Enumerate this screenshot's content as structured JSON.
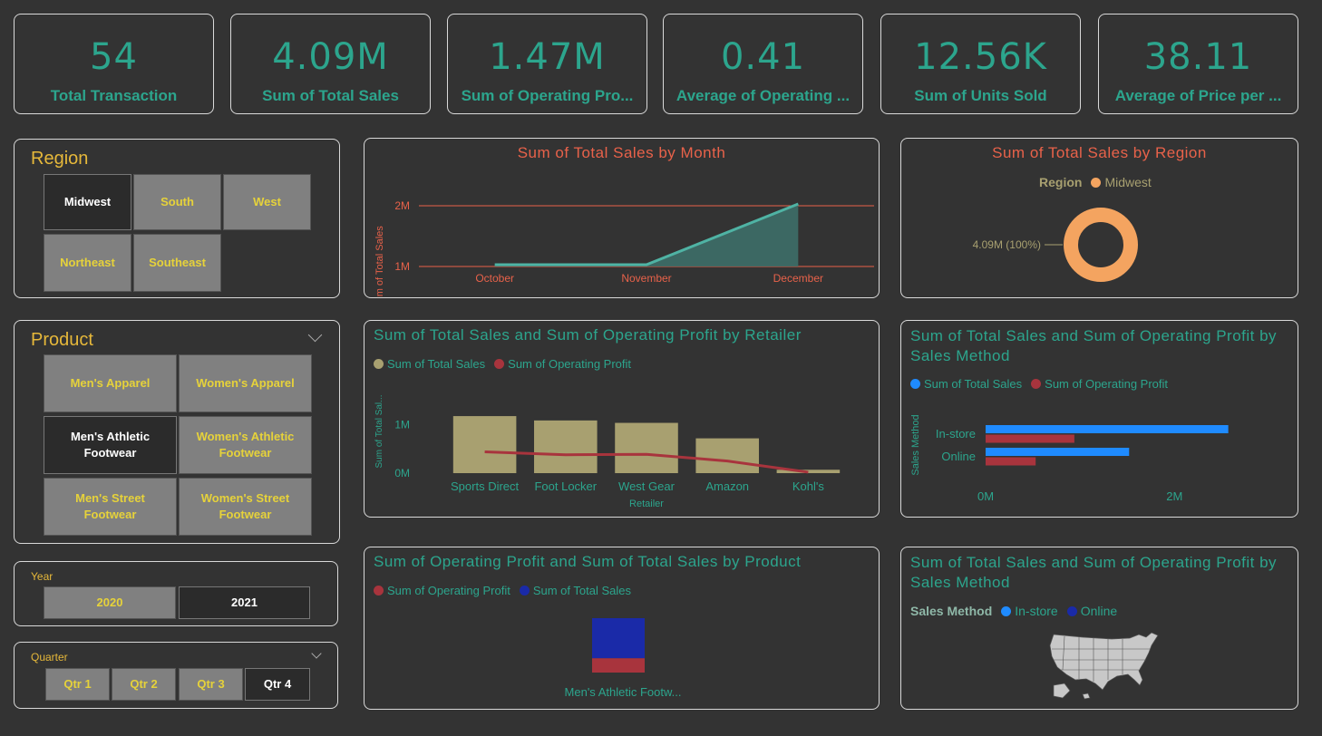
{
  "kpis": [
    {
      "value": "54",
      "label": "Total Transaction"
    },
    {
      "value": "4.09M",
      "label": "Sum of Total Sales"
    },
    {
      "value": "1.47M",
      "label": "Sum of Operating Pro..."
    },
    {
      "value": "0.41",
      "label": "Average of Operating ..."
    },
    {
      "value": "12.56K",
      "label": "Sum of Units Sold"
    },
    {
      "value": "38.11",
      "label": "Average of Price per ..."
    }
  ],
  "region_slicer": {
    "title": "Region",
    "items": [
      "Midwest",
      "South",
      "West",
      "Northeast",
      "Southeast"
    ],
    "selected": "Midwest"
  },
  "product_slicer": {
    "title": "Product",
    "items": [
      "Men's Apparel",
      "Women's Apparel",
      "Men's Athletic Footwear",
      "Women's Athletic Footwear",
      "Men's Street Footwear",
      "Women's Street Footwear"
    ],
    "selected": "Men's Athletic Footwear"
  },
  "year_slicer": {
    "title": "Year",
    "items": [
      "2020",
      "2021"
    ],
    "selected": "2021"
  },
  "quarter_slicer": {
    "title": "Quarter",
    "items": [
      "Qtr 1",
      "Qtr 2",
      "Qtr 3",
      "Qtr 4"
    ],
    "selected": "Qtr 4"
  },
  "colors": {
    "accent": "#2ca58d",
    "title_red": "#e8624a",
    "slicer_yellow": "#e6b83a",
    "khaki": "#a8a070",
    "profit_red": "#a8343d",
    "blue": "#1f8bff",
    "navy": "#1a2aa8",
    "orange": "#f4a460"
  },
  "chart_data": [
    {
      "id": "sales_by_month",
      "type": "area",
      "title": "Sum of Total Sales by Month",
      "ylabel": "Sum of Total Sales",
      "xlabel": "",
      "categories": [
        "October",
        "November",
        "December"
      ],
      "values": [
        1030000,
        1030000,
        2030000
      ],
      "yticks": [
        "1M",
        "2M"
      ],
      "ylim": [
        1000000,
        2000000
      ]
    },
    {
      "id": "sales_by_region",
      "type": "pie",
      "title": "Sum of Total Sales by Region",
      "legend_title": "Region",
      "labels": [
        "Midwest"
      ],
      "values": [
        4090000
      ],
      "data_label": "4.09M (100%)"
    },
    {
      "id": "by_retailer",
      "type": "bar",
      "title": "Sum of Total Sales and Sum of Operating Profit by Retailer",
      "xlabel": "Retailer",
      "ylabel": "Sum of Total Sal...",
      "categories": [
        "Sports Direct",
        "Foot Locker",
        "West Gear",
        "Amazon",
        "Kohl's"
      ],
      "series": [
        {
          "name": "Sum of Total Sales",
          "values": [
            1180000,
            1090000,
            1040000,
            720000,
            70000
          ]
        },
        {
          "name": "Sum of Operating Profit",
          "values": [
            440000,
            380000,
            390000,
            250000,
            20000
          ]
        }
      ],
      "yticks": [
        "0M",
        "1M"
      ],
      "ylim": [
        0,
        1500000
      ]
    },
    {
      "id": "by_sales_method",
      "type": "bar",
      "title": "Sum of Total Sales and Sum of Operating Profit by Sales Method",
      "ylabel": "Sales Method",
      "categories": [
        "In-store",
        "Online"
      ],
      "series": [
        {
          "name": "Sum of Total Sales",
          "values": [
            2570000,
            1520000
          ]
        },
        {
          "name": "Sum of Operating Profit",
          "values": [
            940000,
            530000
          ]
        }
      ],
      "xticks": [
        "0M",
        "2M"
      ],
      "xlim": [
        0,
        2900000
      ]
    },
    {
      "id": "by_product",
      "type": "bar",
      "title": "Sum of Operating Profit and Sum of Total Sales by Product",
      "categories": [
        "Men's Athletic Footw..."
      ],
      "series": [
        {
          "name": "Sum of Operating Profit",
          "values": [
            1470000
          ]
        },
        {
          "name": "Sum of Total Sales",
          "values": [
            4090000
          ]
        }
      ]
    },
    {
      "id": "map_sales_method",
      "type": "map",
      "title": "Sum of Total Sales and Sum of Operating Profit by Sales Method",
      "legend_title": "Sales Method",
      "legend": [
        "In-store",
        "Online"
      ]
    }
  ]
}
